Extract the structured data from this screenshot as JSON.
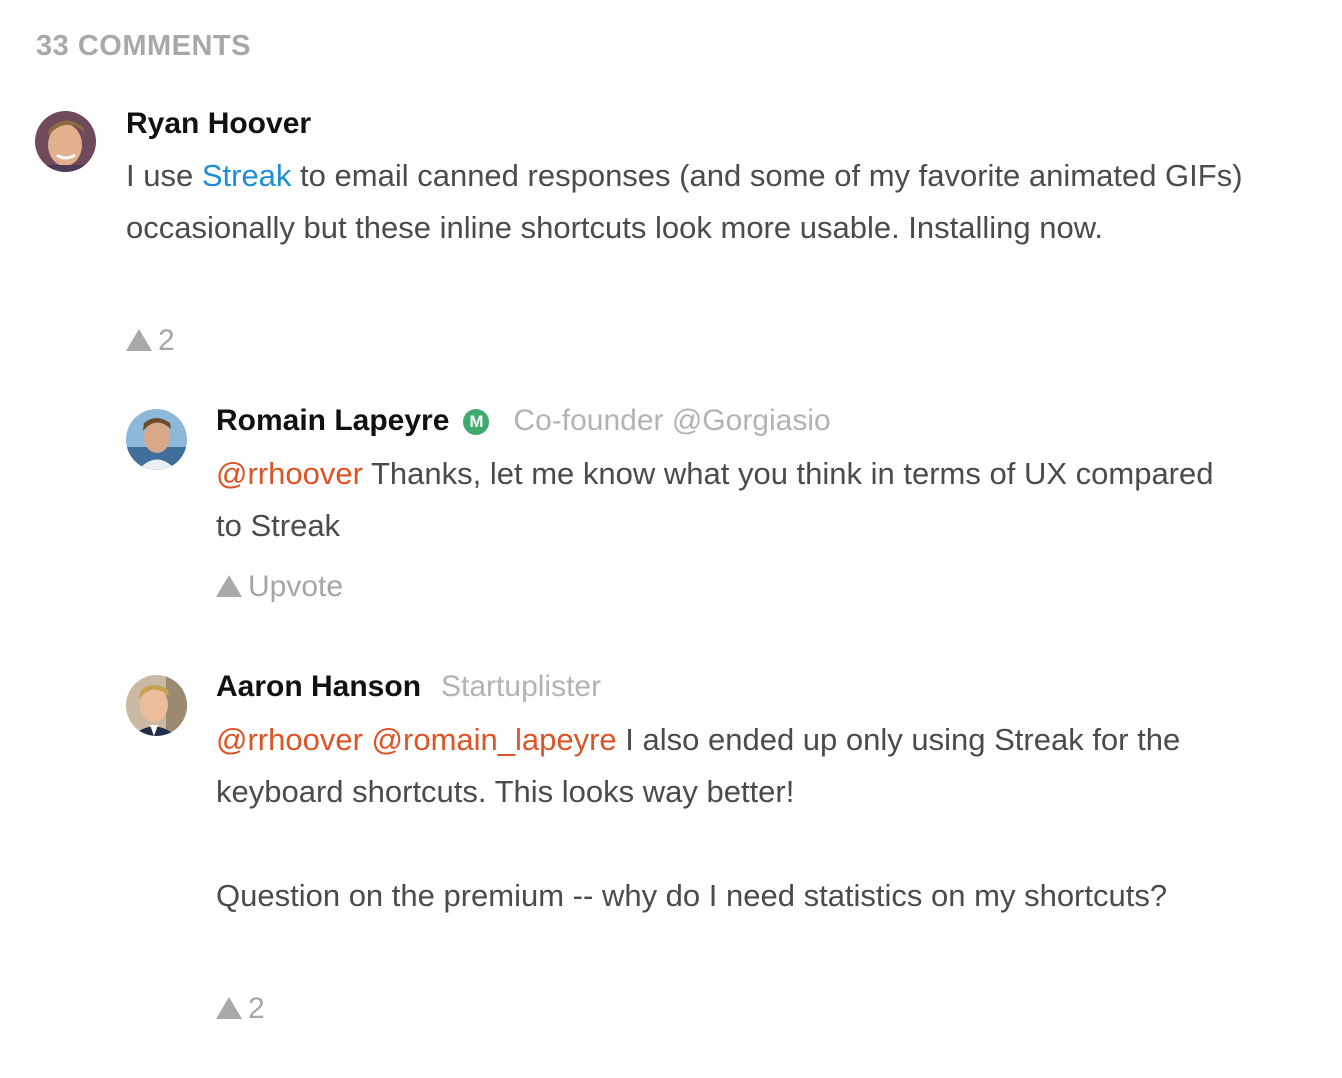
{
  "header": {
    "count_label": "33 COMMENTS"
  },
  "comments": [
    {
      "author": "Ryan Hoover",
      "body_pre": "I use ",
      "body_link": "Streak",
      "body_post": " to email canned responses (and some of my favorite animated GIFs) occasionally but these inline shortcuts look more usable. Installing now.",
      "votes": "2"
    },
    {
      "author": "Romain Lapeyre",
      "badge": "M",
      "headline": "Co-founder @Gorgiasio",
      "mention": "@rrhoover",
      "body": " Thanks, let me know what you think in terms of UX compared to Streak",
      "vote_label": "Upvote"
    },
    {
      "author": "Aaron Hanson",
      "headline": "Startuplister",
      "mention1": "@rrhoover",
      "mention2": "@romain_lapeyre",
      "body": " I also ended up only using Streak for the keyboard shortcuts. This looks way better!",
      "body2": "Question on the premium -- why do I need statistics on my shortcuts?",
      "votes": "2"
    }
  ],
  "colors": {
    "link": "#1e8fd6",
    "mention": "#dc5425",
    "maker_badge": "#3fa96e",
    "muted": "#a8a8a8"
  },
  "icons": {
    "upvote": "upvote-triangle-icon"
  }
}
